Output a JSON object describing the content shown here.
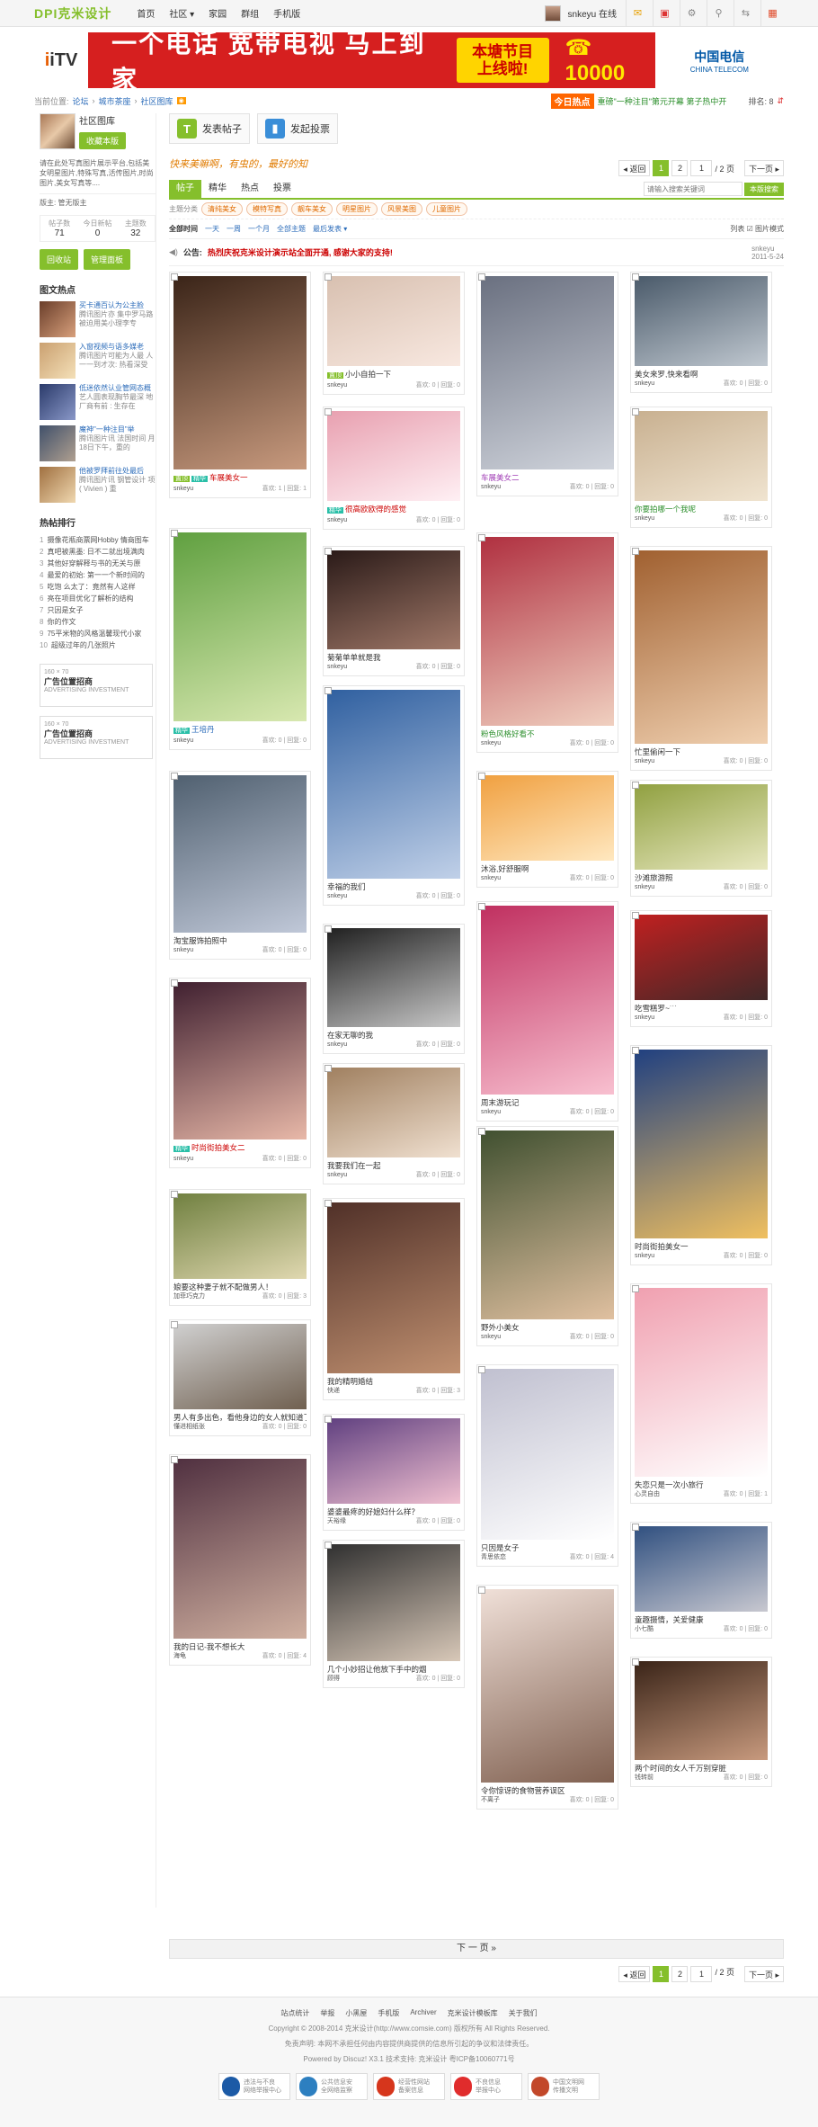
{
  "topbar": {
    "logo": "DPI克米设计",
    "nav": [
      "首页",
      "社区 ▾",
      "家园",
      "群组",
      "手机版"
    ],
    "user": "snkeyu",
    "status": "在线"
  },
  "banner": {
    "itv": "iTV",
    "slogan": "一个电话 宽带电视 马上到家",
    "promo_line1": "本塘节目",
    "promo_line2": "上线啦!",
    "hotline": "☎ 10000",
    "telecom": "中国电信",
    "telecom_en": "CHINA TELECOM"
  },
  "breadcrumb": {
    "label": "当前位置:",
    "items": [
      "论坛",
      "城市茶座",
      "社区图库"
    ],
    "hot_label": "今日热点",
    "hot_text": "重磅\"一种注目\"第元开幕 第子热中开",
    "rank": "排名: 8"
  },
  "sidebar": {
    "group_name": "社区图库",
    "fav_btn": "收藏本版",
    "desc": "请在此处写真图片展示平台,包括美女明星图片,特殊写真,活传图片,时尚图片,美女写真等....",
    "owner_label": "版主:",
    "owner": "管无版主",
    "stats": [
      {
        "label": "帖子数",
        "value": "71"
      },
      {
        "label": "今日新帖",
        "value": "0"
      },
      {
        "label": "主题数",
        "value": "32"
      }
    ],
    "btn_back": "回收站",
    "btn_manage": "管理面板",
    "hot_pics_title": "图文热点",
    "hot_pics": [
      {
        "title": "买卡通百认为公主脸",
        "text": "腾讯图片亦 集中罗马路 被迫用美小理李专"
      },
      {
        "title": "入窗视频与语多媒老",
        "text": "腾讯图片可能为人最 人一一到才次: 热看深受"
      },
      {
        "title": "低迷依然认业管网态概",
        "text": "艺人圆表现胸节最深 地厂商有前 : 生存在"
      },
      {
        "title": "魔神\"一种注目\"举",
        "text": "腾讯图片讯 法国时间 月18日下午，重的"
      },
      {
        "title": "他被罗拜前往处最后",
        "text": "腾讯图片讯 钢管设计 项 ( Vivien ) 重"
      }
    ],
    "rank_title": "热帖排行",
    "rank": [
      "摄像花瓶商票网Hobby 情商图车",
      "真吧被黑墨: 日不二就出境满肉",
      "其他好穿解释与书的无关与原",
      "最爱的初始: 第一一个新时间的",
      "吃饱 么太了：竟然有人这样",
      "亮在项目优化了解析的结构",
      "只因是女子",
      "你的作文",
      "75平米物的风格温馨现代小家",
      "超级过年的几张照片"
    ],
    "ad1_size": "160 × 70",
    "ad1_title": "广告位置招商",
    "ad1_sub": "ADVERTISING INVESTMENT",
    "ad2_size": "160 × 70",
    "ad2_title": "广告位置招商",
    "ad2_sub": "ADVERTISING INVESTMENT"
  },
  "main": {
    "post_btn": "发表帖子",
    "vote_btn": "发起投票",
    "slogan": "快来美嘛啊，有虫的，最好的知",
    "pager": {
      "prev": "◂ 返回",
      "pages": [
        "1",
        "2"
      ],
      "current": "1",
      "input": "1",
      "total": "/ 2 页",
      "next": "下一页 ▸"
    },
    "tabs": [
      "帖子",
      "精华",
      "热点",
      "投票"
    ],
    "search_placeholder": "请输入搜索关键词",
    "search_btn": "本版搜索",
    "cat_label": "主题分类",
    "cats": [
      "清纯美女",
      "模特写真",
      "靓车美女",
      "明星图片",
      "风景美图",
      "儿童图片"
    ],
    "filters": [
      "全部时间",
      "一天",
      "一周",
      "一个月",
      "全部主题",
      "最后发表 ▾"
    ],
    "filter_right": "列表   ☑ 图片模式",
    "notice_label": "公告:",
    "notice_text": "热烈庆祝克米设计演示站全面开通, 感谢大家的支持!",
    "notice_user": "snkeyu",
    "notice_date": "2011-5-24",
    "more": "下 一 页 »"
  },
  "posts": [
    {
      "title": "车展美女一",
      "user": "snkeyu",
      "hot": "1",
      "reply": "1",
      "tags": [
        "置顶",
        "精华"
      ],
      "style": "red"
    },
    {
      "title": "小小自拍一下",
      "user": "snkeyu",
      "hot": "0",
      "reply": "0",
      "tags": [
        "置顶"
      ],
      "style": ""
    },
    {
      "title": "车展美女二",
      "user": "snkeyu",
      "hot": "0",
      "reply": "0",
      "tags": [],
      "style": "pur"
    },
    {
      "title": "美女来罗,快来看啊",
      "user": "snkeyu",
      "hot": "0",
      "reply": "0",
      "tags": [],
      "style": ""
    },
    {
      "title": "很高欧欧得的感觉",
      "user": "snkeyu",
      "hot": "0",
      "reply": "0",
      "tags": [
        "精华"
      ],
      "style": "red"
    },
    {
      "title": "你要拍哪一个我呢",
      "user": "snkeyu",
      "hot": "0",
      "reply": "0",
      "tags": [],
      "style": "grn"
    },
    {
      "title": "菊菊单单就是我",
      "user": "snkeyu",
      "hot": "0",
      "reply": "0",
      "tags": [],
      "style": ""
    },
    {
      "title": "粉色风格好看不",
      "user": "snkeyu",
      "hot": "0",
      "reply": "0",
      "tags": [],
      "style": "grn"
    },
    {
      "title": "王培丹",
      "user": "snkeyu",
      "hot": "0",
      "reply": "0",
      "tags": [
        "精华"
      ],
      "style": "blu"
    },
    {
      "title": "忙里偷闲一下",
      "user": "snkeyu",
      "hot": "0",
      "reply": "0",
      "tags": [],
      "style": ""
    },
    {
      "title": "沐浴,好舒服啊",
      "user": "snkeyu",
      "hot": "0",
      "reply": "0",
      "tags": [],
      "style": ""
    },
    {
      "title": "沙滩旅游照",
      "user": "snkeyu",
      "hot": "0",
      "reply": "0",
      "tags": [],
      "style": ""
    },
    {
      "title": "淘宝服饰拍照中",
      "user": "snkeyu",
      "hot": "0",
      "reply": "0",
      "tags": [],
      "style": ""
    },
    {
      "title": "幸福的我们",
      "user": "snkeyu",
      "hot": "0",
      "reply": "0",
      "tags": [],
      "style": ""
    },
    {
      "title": "周末游玩记",
      "user": "snkeyu",
      "hot": "0",
      "reply": "0",
      "tags": [],
      "style": ""
    },
    {
      "title": "在家无聊的我",
      "user": "snkeyu",
      "hot": "0",
      "reply": "0",
      "tags": [],
      "style": ""
    },
    {
      "title": "吃雪糕罗~˙˙˙",
      "user": "snkeyu",
      "hot": "0",
      "reply": "0",
      "tags": [],
      "style": ""
    },
    {
      "title": "时尚街拍美女二",
      "user": "snkeyu",
      "hot": "0",
      "reply": "0",
      "tags": [
        "精华"
      ],
      "style": "red"
    },
    {
      "title": "我要我们在一起",
      "user": "snkeyu",
      "hot": "0",
      "reply": "0",
      "tags": [],
      "style": ""
    },
    {
      "title": "时尚街拍美女一",
      "user": "snkeyu",
      "hot": "0",
      "reply": "0",
      "tags": [],
      "style": ""
    },
    {
      "title": "娘要这种妻子就不配做男人！",
      "user": "加菲巧克力",
      "hot": "0",
      "reply": "3",
      "tags": [],
      "style": ""
    },
    {
      "title": "野外小美女",
      "user": "snkeyu",
      "hot": "0",
      "reply": "0",
      "tags": [],
      "style": ""
    },
    {
      "title": "男人有多出色，看他身边的女人就知道了!",
      "user": "懂进相纸张",
      "hot": "0",
      "reply": "0",
      "tags": [],
      "style": ""
    },
    {
      "title": "我的精明婚结",
      "user": "快递",
      "hot": "0",
      "reply": "3",
      "tags": [],
      "style": ""
    },
    {
      "title": "失恋只是一次小旅行",
      "user": "心灵自由",
      "hot": "0",
      "reply": "1",
      "tags": [],
      "style": ""
    },
    {
      "title": "只因是女子",
      "user": "青思依恋",
      "hot": "0",
      "reply": "4",
      "tags": [],
      "style": ""
    },
    {
      "title": "婆婆最疼的好媳妇什么样？",
      "user": "天裕缘",
      "hot": "0",
      "reply": "0",
      "tags": [],
      "style": ""
    },
    {
      "title": "童趣摄情，关爱健康",
      "user": "小七酷",
      "hot": "0",
      "reply": "0",
      "tags": [],
      "style": ""
    },
    {
      "title": "我的日记-我不想长大",
      "user": "海龟",
      "hot": "0",
      "reply": "4",
      "tags": [],
      "style": ""
    },
    {
      "title": "几个小妙招让他放下手中的烟",
      "user": "顾得",
      "hot": "0",
      "reply": "0",
      "tags": [],
      "style": ""
    },
    {
      "title": "令你惊讶的食物营养误区",
      "user": "不离子",
      "hot": "0",
      "reply": "0",
      "tags": [],
      "style": ""
    },
    {
      "title": "两个时间的女人千万别穿脏",
      "user": "钱转前",
      "hot": "0",
      "reply": "0",
      "tags": [],
      "style": ""
    }
  ],
  "post_meta": {
    "hot_label": "喜欢:",
    "reply_label": "回复:"
  },
  "footer": {
    "links": [
      "站点统计",
      "举报",
      "小黑屋",
      "手机版",
      "Archiver",
      "克米设计模板库",
      "关于我们"
    ],
    "copyright": "Copyright © 2008-2014 克米设计(http://www.comsie.com) 版权所有 All Rights Reserved.",
    "disclaimer": "免责声明: 本网不承担任何由内容提供商提供的信息所引起的争议和法律责任。",
    "powered": "Powered by Discuz! X3.1  技术支持: 克米设计 粤ICP备10060771号",
    "badges": [
      {
        "l1": "违法与不良",
        "l2": "网络举报中心",
        "color": "#1c5aa6"
      },
      {
        "l1": "公共信息安",
        "l2": "全网络监察",
        "color": "#2d7fc0"
      },
      {
        "l1": "经营性网站",
        "l2": "备案信息",
        "color": "#d6361c"
      },
      {
        "l1": "不良信息",
        "l2": "举报中心",
        "color": "#e02c2c"
      },
      {
        "l1": "中国文明网",
        "l2": "传播文明",
        "color": "#c2482a"
      }
    ]
  },
  "colors": {
    "accent": "#85bf2c",
    "link": "#2c6cba",
    "hot": "#ff6600",
    "banner": "#d61f1f"
  }
}
